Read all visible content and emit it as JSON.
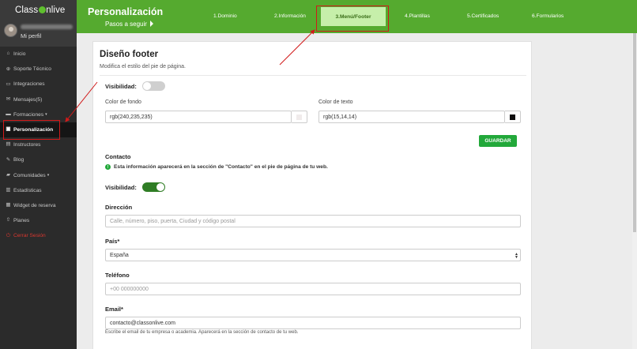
{
  "sidebar": {
    "logo_left": "Class",
    "logo_right": "nlive",
    "profile_label": "Mi perfil",
    "items": [
      {
        "label": "Inicio",
        "icon": "home-icon",
        "glyph": "⌂"
      },
      {
        "label": "Soporte Técnico",
        "icon": "support-icon",
        "glyph": "⊕"
      },
      {
        "label": "Integraciones",
        "icon": "integrations-icon",
        "glyph": "▭"
      },
      {
        "label": "Mensajes(5)",
        "icon": "envelope-icon",
        "glyph": "✉"
      },
      {
        "label": "Formaciones",
        "icon": "folder-icon",
        "glyph": "▬",
        "caret": "▾"
      },
      {
        "label": "Personalización",
        "icon": "desktop-icon",
        "glyph": "▣",
        "active": true
      },
      {
        "label": "Instructores",
        "icon": "instructors-icon",
        "glyph": "▤"
      },
      {
        "label": "Blog",
        "icon": "pencil-icon",
        "glyph": "✎"
      },
      {
        "label": "Comunidades",
        "icon": "comments-icon",
        "glyph": "▰",
        "caret": "▾"
      },
      {
        "label": "Estadísticas",
        "icon": "chart-icon",
        "glyph": "▥"
      },
      {
        "label": "Widget de reserva",
        "icon": "calendar-icon",
        "glyph": "▦"
      },
      {
        "label": "Planes",
        "icon": "upload-icon",
        "glyph": "⇧"
      },
      {
        "label": "Cerrar Sesión",
        "icon": "power-icon",
        "glyph": "⏻",
        "logout": true
      }
    ]
  },
  "header": {
    "title": "Personalización",
    "subtitle": "Pasos a seguir",
    "steps": [
      "1.Dominio",
      "2.Información",
      "3.Menú/Footer",
      "4.Plantillas",
      "5.Certificados",
      "6.Formularios"
    ]
  },
  "card": {
    "title": "Diseño footer",
    "subtitle": "Modifica el estilo del pie de página.",
    "visibility_label": "Visibilidad:",
    "bg_color_label": "Color de fondo",
    "bg_color_value": "rgb(240,235,235)",
    "bg_swatch_color": "#f0ebeb",
    "text_color_label": "Color de texto",
    "text_color_value": "rgb(15,14,14)",
    "text_swatch_color": "#0f0e0e",
    "save_label": "GUARDAR",
    "contact_heading": "Contacto",
    "contact_info": "Esta información aparecerá en la sección de \"Contacto\" en el pie de página de tu web.",
    "contact_visibility_label": "Visibilidad:",
    "address_label": "Dirección",
    "address_placeholder": "Calle, número, piso, puerta, Ciudad y código postal",
    "country_label": "País*",
    "country_value": "España",
    "phone_label": "Teléfono",
    "phone_placeholder": "+00 000000000",
    "email_label": "Email*",
    "email_value": "contacto@classonlive.com",
    "email_help": "Escribe el email de tu empresa o academia. Aparecerá en la sección de contacto de tu web."
  },
  "colors": {
    "header_green": "#55aa2f",
    "active_step_bg": "#c6efaa",
    "save_button": "#22a83a",
    "toggle_on": "#2f7d25",
    "annotation_red": "#d11a1a",
    "logout_red": "#d9372f"
  }
}
